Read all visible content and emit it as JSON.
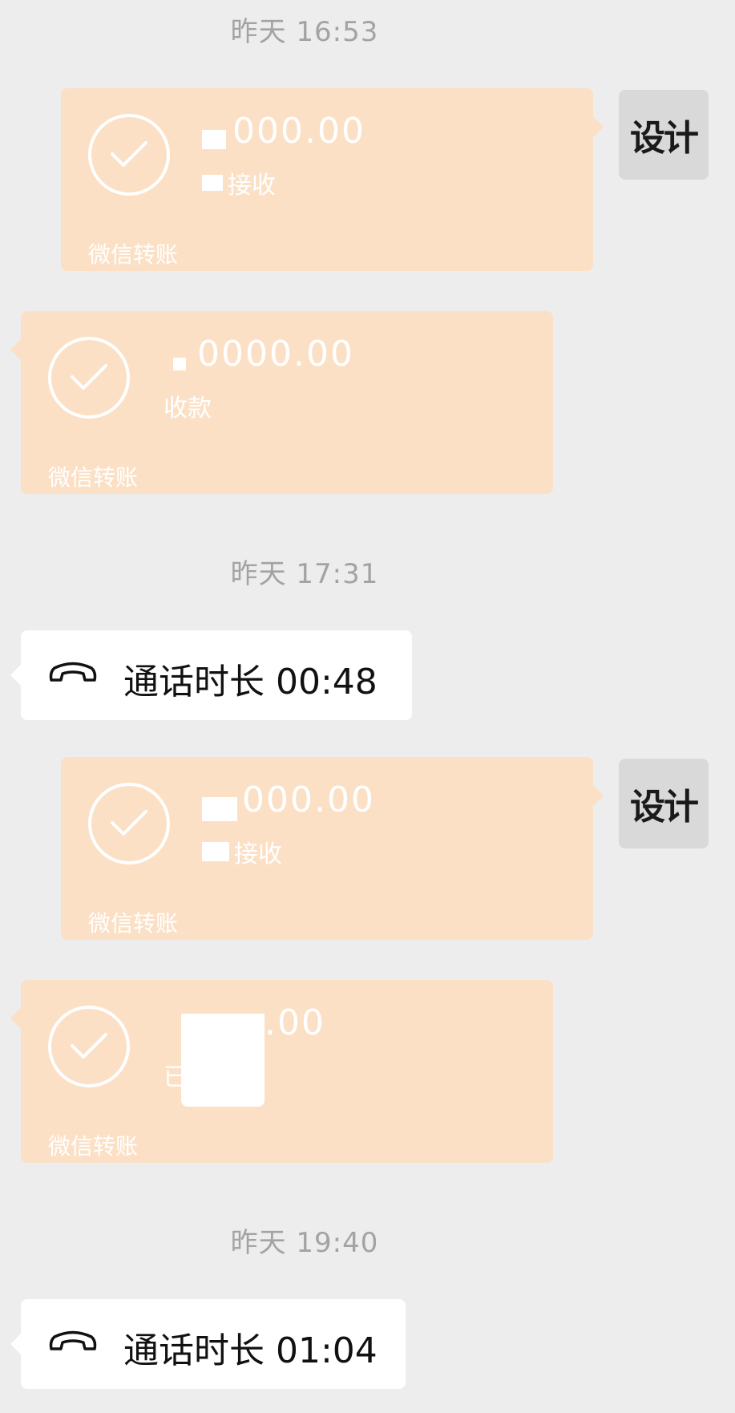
{
  "chat": {
    "timestamps": [
      "昨天 16:53",
      "昨天 17:31",
      "昨天 19:40"
    ],
    "avatar_label": "设计",
    "transfers": [
      {
        "amount": "000.00",
        "status": "接收",
        "footer": "微信转账"
      },
      {
        "amount": "0000.00",
        "status": "收款",
        "footer": "微信转账"
      },
      {
        "amount": "000.00",
        "status": "接收",
        "footer": "微信转账"
      },
      {
        "amount": ".00",
        "status": "已",
        "footer": "微信转账"
      }
    ],
    "calls": [
      {
        "text": "通话时长 00:48"
      },
      {
        "text": "通话时长 01:04"
      }
    ]
  },
  "colors": {
    "background": "#ededed",
    "transfer_bubble": "#fbe0c6",
    "call_bubble": "#ffffff",
    "timestamp_text": "#a3a3a3"
  },
  "icons": {
    "check": "check-circle-icon",
    "phone": "phone-hangup-icon"
  }
}
